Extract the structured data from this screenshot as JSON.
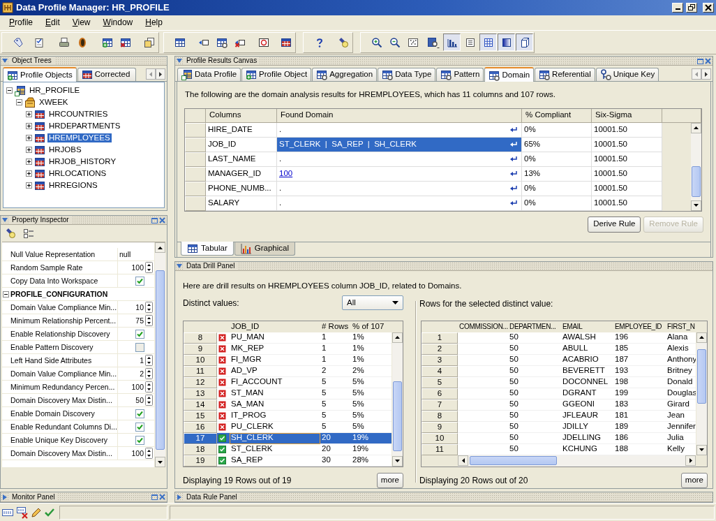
{
  "window": {
    "title": "Data Profile Manager: HR_PROFILE"
  },
  "menu": [
    "Profile",
    "Edit",
    "View",
    "Window",
    "Help"
  ],
  "toolbar": {
    "toggles": [
      {
        "selected": true
      },
      {
        "selected": false
      },
      {
        "selected": true
      },
      {
        "selected": true
      },
      {
        "selected": true
      }
    ]
  },
  "object_trees": {
    "title": "Object Trees",
    "expanded": true,
    "tabs": [
      {
        "label": "Profile Objects",
        "selected": true
      },
      {
        "label": "Corrected",
        "selected": false
      }
    ],
    "tree": [
      {
        "label": "HR_PROFILE",
        "kind": "profile",
        "expanded": true,
        "selected": false,
        "children": [
          {
            "label": "XWEEK",
            "kind": "module",
            "expanded": true,
            "selected": false,
            "children": [
              {
                "label": "HRCOUNTRIES",
                "kind": "table",
                "expanded": false,
                "selected": false
              },
              {
                "label": "HRDEPARTMENTS",
                "kind": "table",
                "expanded": false,
                "selected": false
              },
              {
                "label": "HREMPLOYEES",
                "kind": "table",
                "expanded": false,
                "selected": true
              },
              {
                "label": "HRJOBS",
                "kind": "table",
                "expanded": false,
                "selected": false
              },
              {
                "label": "HRJOB_HISTORY",
                "kind": "table",
                "expanded": false,
                "selected": false
              },
              {
                "label": "HRLOCATIONS",
                "kind": "table",
                "expanded": false,
                "selected": false
              },
              {
                "label": "HRREGIONS",
                "kind": "table",
                "expanded": false,
                "selected": false
              }
            ]
          }
        ]
      }
    ]
  },
  "property_inspector": {
    "title": "Property Inspector",
    "expanded": true,
    "rows": [
      {
        "kind": "text",
        "label": "Null Value Representation",
        "value": "null"
      },
      {
        "kind": "spin",
        "label": "Random Sample Rate",
        "value": "100"
      },
      {
        "kind": "check",
        "label": "Copy Data Into Workspace",
        "checked": true
      },
      {
        "kind": "group",
        "label": "PROFILE_CONFIGURATION",
        "expanded": true
      },
      {
        "kind": "spin",
        "label": "Domain Value Compliance Min...",
        "value": "10"
      },
      {
        "kind": "spin",
        "label": "Minimum Relationship Percent...",
        "value": "75"
      },
      {
        "kind": "check",
        "label": "Enable Relationship Discovery",
        "checked": true
      },
      {
        "kind": "check",
        "label": "Enable Pattern Discovery",
        "checked": false
      },
      {
        "kind": "spin",
        "label": "Left Hand Side Attributes",
        "value": "1"
      },
      {
        "kind": "spin",
        "label": "Domain Value Compliance Min...",
        "value": "2"
      },
      {
        "kind": "spin",
        "label": "Minimum Redundancy Percen...",
        "value": "100"
      },
      {
        "kind": "spin",
        "label": "Domain Discovery Max Distin...",
        "value": "50"
      },
      {
        "kind": "check",
        "label": "Enable Domain Discovery",
        "checked": true
      },
      {
        "kind": "check",
        "label": "Enable Redundant Columns Di...",
        "checked": true
      },
      {
        "kind": "check",
        "label": "Enable Unique Key Discovery",
        "checked": true
      },
      {
        "kind": "spin",
        "label": "Domain Discovery Max Distin...",
        "value": "100"
      }
    ]
  },
  "monitor_panel": {
    "title": "Monitor Panel",
    "expanded": false
  },
  "results_canvas": {
    "title": "Profile Results Canvas",
    "expanded": true,
    "tabs": [
      {
        "label": "Data Profile",
        "kind": "profile",
        "selected": false
      },
      {
        "label": "Profile Object",
        "kind": "object",
        "selected": false
      },
      {
        "label": "Aggregation",
        "kind": "gear",
        "selected": false
      },
      {
        "label": "Data Type",
        "kind": "gear",
        "selected": false
      },
      {
        "label": "Pattern",
        "kind": "gear",
        "selected": false
      },
      {
        "label": "Domain",
        "kind": "gear",
        "selected": true
      },
      {
        "label": "Referential",
        "kind": "gear",
        "selected": false
      },
      {
        "label": "Unique Key",
        "kind": "key",
        "selected": false
      }
    ],
    "summary": "The following are the domain analysis results for HREMPLOYEES, which has 11 columns and 107 rows.",
    "columns": [
      "Columns",
      "Found Domain",
      "% Compliant",
      "Six-Sigma"
    ],
    "rows": [
      {
        "column": "HIRE_DATE",
        "domain": ".",
        "link": false,
        "compliant": "0%",
        "six_sigma": "10001.50",
        "selected": false
      },
      {
        "column": "JOB_ID",
        "domain": "ST_CLERK  |  SA_REP  |  SH_CLERK",
        "link": false,
        "compliant": "65%",
        "six_sigma": "10001.50",
        "selected": true
      },
      {
        "column": "LAST_NAME",
        "domain": ".",
        "link": false,
        "compliant": "0%",
        "six_sigma": "10001.50",
        "selected": false
      },
      {
        "column": "MANAGER_ID",
        "domain": "100",
        "link": true,
        "compliant": "13%",
        "six_sigma": "10001.50",
        "selected": false
      },
      {
        "column": "PHONE_NUMB...",
        "domain": ".",
        "link": false,
        "compliant": "0%",
        "six_sigma": "10001.50",
        "selected": false
      },
      {
        "column": "SALARY",
        "domain": ".",
        "link": false,
        "compliant": "0%",
        "six_sigma": "10001.50",
        "selected": false
      }
    ],
    "buttons": [
      {
        "label": "Derive Rule",
        "disabled": false
      },
      {
        "label": "Remove Rule",
        "disabled": true
      }
    ],
    "view_tabs": [
      {
        "label": "Tabular",
        "kind": "table",
        "selected": true
      },
      {
        "label": "Graphical",
        "kind": "chart",
        "selected": false
      }
    ]
  },
  "drill_panel": {
    "title": "Data Drill Panel",
    "expanded": true,
    "summary": "Here are drill results on HREMPLOYEES column JOB_ID, related to Domains.",
    "distinct": {
      "label": "Distinct values:",
      "filter": "All",
      "columns": [
        "JOB_ID",
        "# Rows",
        "% of 107"
      ],
      "rows": [
        {
          "index": "8",
          "compliant": false,
          "value": "PU_MAN",
          "count": "1",
          "percent": "1%",
          "selected": false
        },
        {
          "index": "9",
          "compliant": false,
          "value": "MK_REP",
          "count": "1",
          "percent": "1%",
          "selected": false
        },
        {
          "index": "10",
          "compliant": false,
          "value": "FI_MGR",
          "count": "1",
          "percent": "1%",
          "selected": false
        },
        {
          "index": "11",
          "compliant": false,
          "value": "AD_VP",
          "count": "2",
          "percent": "2%",
          "selected": false
        },
        {
          "index": "12",
          "compliant": false,
          "value": "FI_ACCOUNT",
          "count": "5",
          "percent": "5%",
          "selected": false
        },
        {
          "index": "13",
          "compliant": false,
          "value": "ST_MAN",
          "count": "5",
          "percent": "5%",
          "selected": false
        },
        {
          "index": "14",
          "compliant": false,
          "value": "SA_MAN",
          "count": "5",
          "percent": "5%",
          "selected": false
        },
        {
          "index": "15",
          "compliant": false,
          "value": "IT_PROG",
          "count": "5",
          "percent": "5%",
          "selected": false
        },
        {
          "index": "16",
          "compliant": false,
          "value": "PU_CLERK",
          "count": "5",
          "percent": "5%",
          "selected": false
        },
        {
          "index": "17",
          "compliant": true,
          "value": "SH_CLERK",
          "count": "20",
          "percent": "19%",
          "selected": true
        },
        {
          "index": "18",
          "compliant": true,
          "value": "ST_CLERK",
          "count": "20",
          "percent": "19%",
          "selected": false
        },
        {
          "index": "19",
          "compliant": true,
          "value": "SA_REP",
          "count": "30",
          "percent": "28%",
          "selected": false
        }
      ],
      "status": "Displaying 19 Rows out of 19",
      "more": "more"
    },
    "rows_view": {
      "label": "Rows for the selected distinct value:",
      "columns": [
        "COMMISSION...",
        "DEPARTMEN...",
        "EMAIL",
        "EMPLOYEE_ID",
        "FIRST_N"
      ],
      "rows": [
        {
          "index": "1",
          "department": "50",
          "email": "AWALSH",
          "employee_id": "196",
          "first_name": "Alana"
        },
        {
          "index": "2",
          "department": "50",
          "email": "ABULL",
          "employee_id": "185",
          "first_name": "Alexis"
        },
        {
          "index": "3",
          "department": "50",
          "email": "ACABRIO",
          "employee_id": "187",
          "first_name": "Anthony"
        },
        {
          "index": "4",
          "department": "50",
          "email": "BEVERETT",
          "employee_id": "193",
          "first_name": "Britney"
        },
        {
          "index": "5",
          "department": "50",
          "email": "DOCONNEL",
          "employee_id": "198",
          "first_name": "Donald"
        },
        {
          "index": "6",
          "department": "50",
          "email": "DGRANT",
          "employee_id": "199",
          "first_name": "Douglas"
        },
        {
          "index": "7",
          "department": "50",
          "email": "GGEONI",
          "employee_id": "183",
          "first_name": "Girard"
        },
        {
          "index": "8",
          "department": "50",
          "email": "JFLEAUR",
          "employee_id": "181",
          "first_name": "Jean"
        },
        {
          "index": "9",
          "department": "50",
          "email": "JDILLY",
          "employee_id": "189",
          "first_name": "Jennifer"
        },
        {
          "index": "10",
          "department": "50",
          "email": "JDELLING",
          "employee_id": "186",
          "first_name": "Julia"
        },
        {
          "index": "11",
          "department": "50",
          "email": "KCHUNG",
          "employee_id": "188",
          "first_name": "Kelly"
        }
      ],
      "status": "Displaying 20 Rows out of 20",
      "more": "more"
    }
  },
  "data_rule_panel": {
    "title": "Data Rule Panel",
    "expanded": false
  }
}
